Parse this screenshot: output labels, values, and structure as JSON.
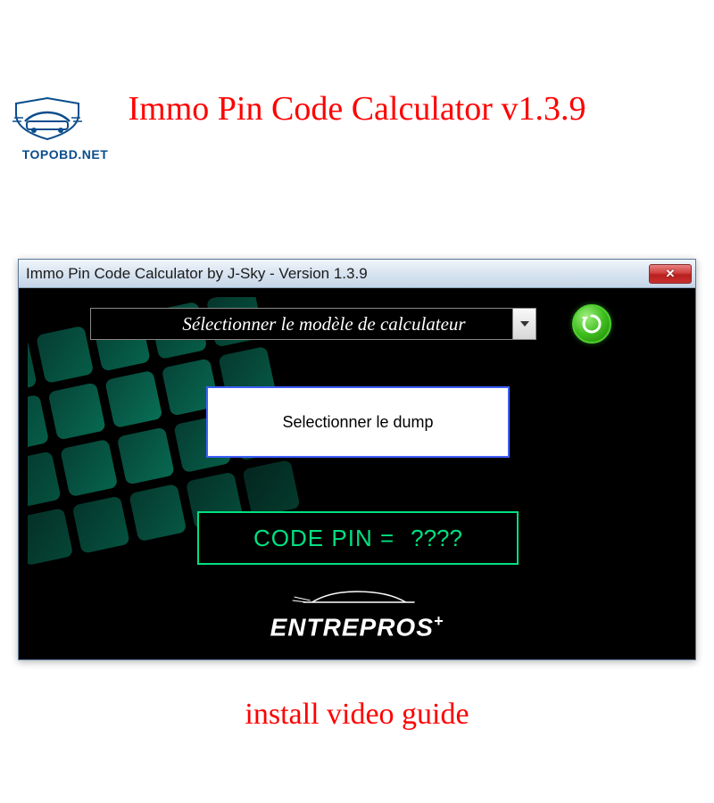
{
  "logo": {
    "text": "TOPOBD.NET"
  },
  "titles": {
    "main": "Immo Pin Code Calculator v1.3.9",
    "bottom": "install video guide"
  },
  "window": {
    "title": "Immo Pin Code Calculator by J-Sky  -  Version 1.3.9",
    "dropdown_text": "Sélectionner le modèle de calculateur",
    "select_dump": "Selectionner le dump",
    "code_label": "CODE PIN =",
    "code_value": "????",
    "brand": "ENTREPROS",
    "brand_plus": "+"
  },
  "colors": {
    "accent_red": "#ff0000",
    "accent_green": "#00e080",
    "logo_blue": "#0a4d8c"
  }
}
